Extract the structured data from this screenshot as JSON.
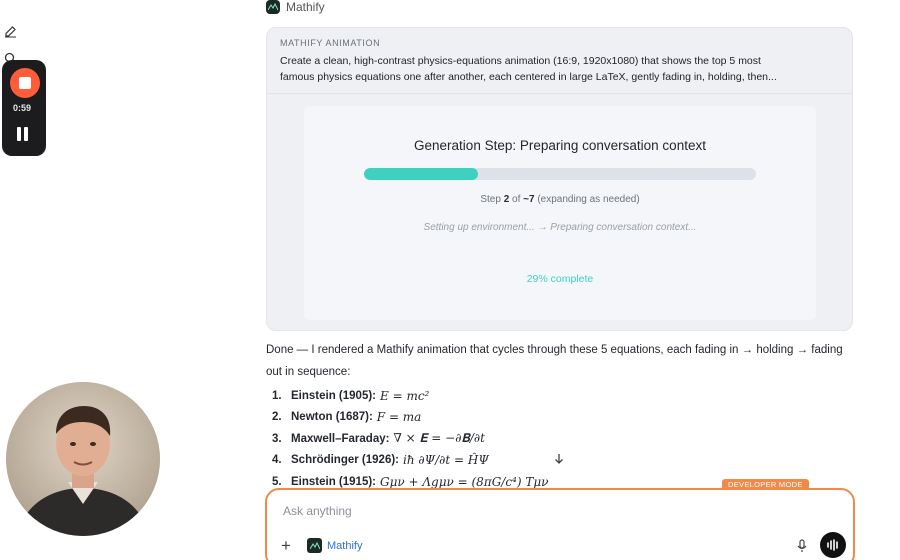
{
  "app": {
    "name": "Mathify"
  },
  "recorder": {
    "elapsed": "0:59"
  },
  "animation_card": {
    "kicker": "MATHIFY ANIMATION",
    "prompt_line1": "Create a clean, high-contrast physics-equations animation (16:9, 1920x1080) that shows the top 5 most",
    "prompt_line2": "famous physics equations one after another, each centered in large LaTeX, gently fading in, holding, then..."
  },
  "generation": {
    "title": "Generation Step: Preparing conversation context",
    "progress_fraction": 0.29,
    "step_prefix": "Step ",
    "step_current": "2",
    "step_mid": " of ",
    "step_total": "~7",
    "step_suffix": " (expanding as needed)",
    "sub_status": "Setting up environment... → Preparing conversation context...",
    "percent_label": "29% complete"
  },
  "reply": {
    "text": "Done — I rendered a Mathify animation that cycles through these 5 equations, each fading in → holding → fading out in sequence:",
    "equations": [
      {
        "num": "1.",
        "name": "Einstein (1905):",
        "math": "E = mc²"
      },
      {
        "num": "2.",
        "name": "Newton (1687):",
        "math": "F = ma"
      },
      {
        "num": "3.",
        "name": "Maxwell–Faraday:",
        "math": "∇ × 𝐄 = −∂𝐁/∂t"
      },
      {
        "num": "4.",
        "name": "Schrödinger (1926):",
        "math": "iħ ∂Ψ/∂t = ĤΨ"
      },
      {
        "num": "5.",
        "name": "Einstein (1915):",
        "math": "Gμν + Λgμν = (8πG/c⁴) Tμν"
      }
    ]
  },
  "badge": {
    "label": "DEVELOPER MODE"
  },
  "composer": {
    "placeholder": "Ask anything",
    "tool_label": "Mathify"
  },
  "colors": {
    "accent_orange": "#f08a4b",
    "progress_teal": "#3fd0bf",
    "record_red": "#ff5c3a"
  },
  "icons": [
    "edit-icon",
    "search-icon",
    "stop-record-icon",
    "pause-icon",
    "mathify-logo-icon",
    "chevron-down-icon",
    "plus-icon",
    "mic-icon",
    "voice-wave-icon"
  ]
}
